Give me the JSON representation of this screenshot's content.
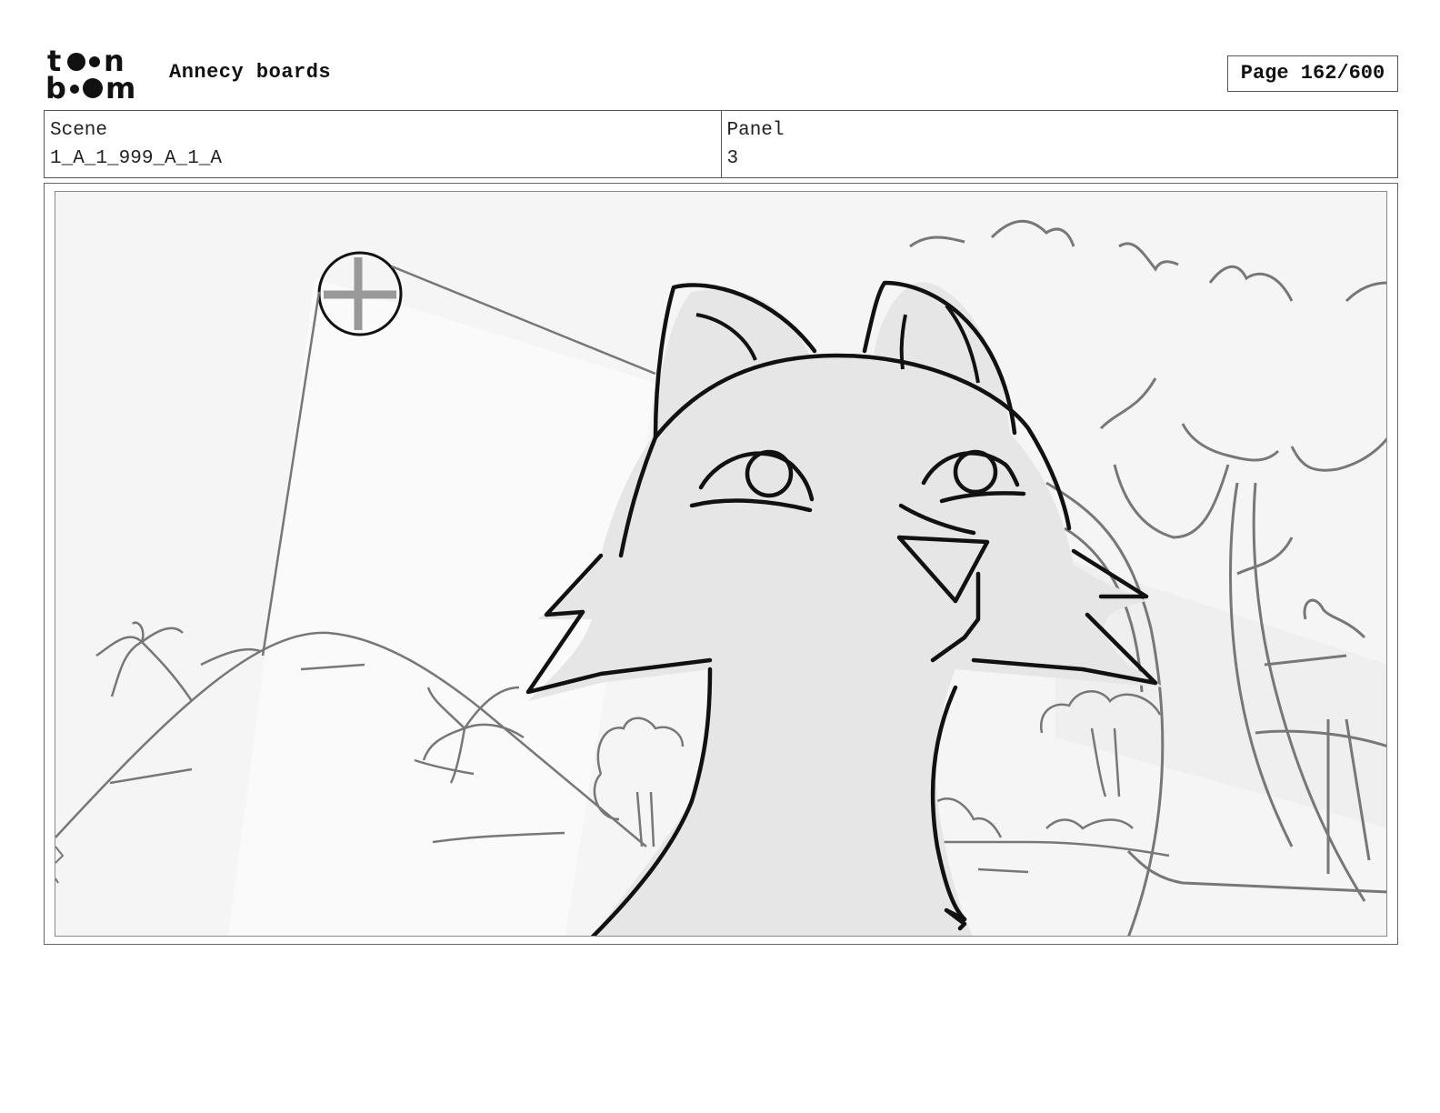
{
  "header": {
    "logo_text": "toon boom",
    "project_title": "Annecy boards",
    "page_indicator": "Page 162/600"
  },
  "info": {
    "scene": {
      "label": "Scene",
      "value": "1_A_1_999_A_1_A"
    },
    "panel": {
      "label": "Panel",
      "value": "3"
    }
  },
  "panel_image": {
    "icon": "storyboard-sketch-fox-icon"
  },
  "colors": {
    "ink": "#111111",
    "sketch_gray": "#777777",
    "fill_light": "#f5f5f5",
    "fill_character": "#e6e6e6"
  }
}
